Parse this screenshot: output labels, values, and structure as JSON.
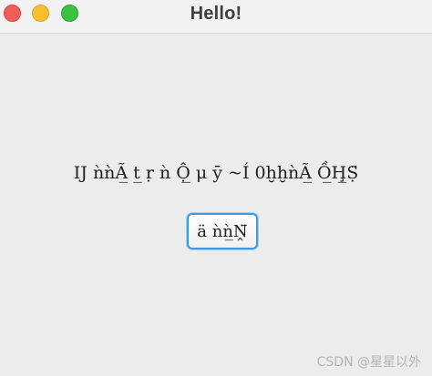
{
  "window": {
    "title": "Hello!"
  },
  "content": {
    "label_text": "IJ ǹǹÃ̲ t̲ ṛ ǹ Ộ̲ μ ȳ ~Í 0ḫḫǹÃ̲ Ồ̲Ḩ̲Ṣ̈",
    "button_label": "ä ǹǹ̲Ṋ̈"
  },
  "watermark": {
    "text": "CSDN @星星以外"
  },
  "colors": {
    "close": "#ee5f58",
    "minimize": "#f7bf2f",
    "maximize": "#3ac244",
    "button_focus": "#3b9ae6"
  }
}
